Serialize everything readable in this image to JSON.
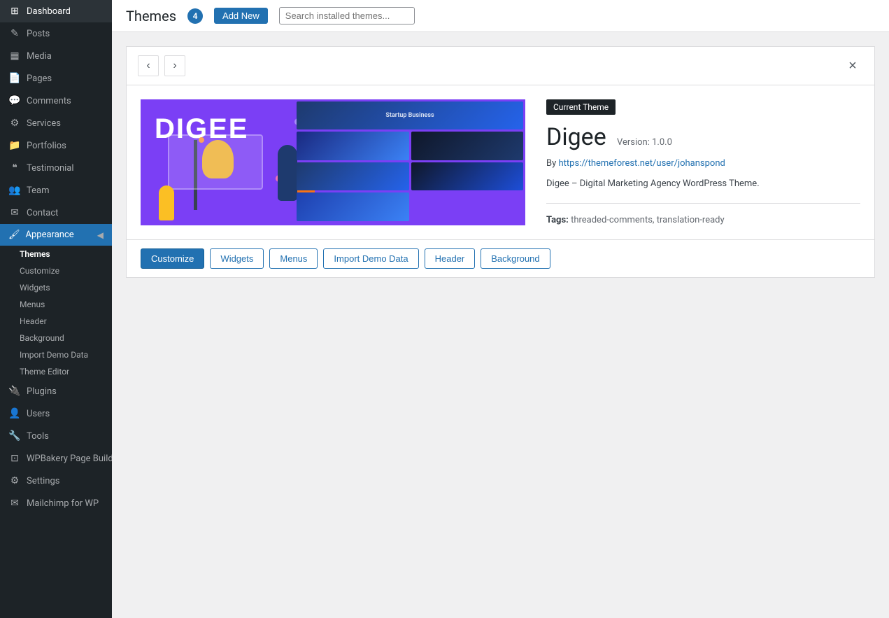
{
  "page_title": "Themes",
  "theme_count": "4",
  "topbar": {
    "title": "Themes",
    "add_new_label": "Add New",
    "search_placeholder": "Search installed themes..."
  },
  "sidebar": {
    "dashboard_label": "Dashboard",
    "posts_label": "Posts",
    "media_label": "Media",
    "pages_label": "Pages",
    "comments_label": "Comments",
    "services_label": "Services",
    "portfolios_label": "Portfolios",
    "testimonial_label": "Testimonial",
    "team_label": "Team",
    "contact_label": "Contact",
    "appearance_label": "Appearance",
    "themes_label": "Themes",
    "customize_label": "Customize",
    "widgets_label": "Widgets",
    "menus_label": "Menus",
    "header_label": "Header",
    "background_label": "Background",
    "import_demo_label": "Import Demo Data",
    "theme_editor_label": "Theme Editor",
    "plugins_label": "Plugins",
    "users_label": "Users",
    "tools_label": "Tools",
    "wpbakery_label": "WPBakery Page Builder",
    "settings_label": "Settings",
    "mailchimp_label": "Mailchimp for WP"
  },
  "theme": {
    "current_badge": "Current Theme",
    "name": "Digee",
    "version_label": "Version: 1.0.0",
    "author_prefix": "By",
    "author_url": "https://themeforest.net/user/johanspond",
    "author_url_text": "https://themeforest.net/user/johanspond",
    "description": "Digee – Digital Marketing Agency WordPress Theme.",
    "tags_label": "Tags:",
    "tags": "threaded-comments, translation-ready"
  },
  "bottom_bar": {
    "customize_label": "Customize",
    "widgets_label": "Widgets",
    "menus_label": "Menus",
    "import_demo_label": "Import Demo Data",
    "header_label": "Header",
    "background_label": "Background"
  },
  "icons": {
    "dashboard": "⊞",
    "posts": "✎",
    "media": "🎞",
    "pages": "📄",
    "comments": "💬",
    "services": "✦",
    "portfolios": "📁",
    "testimonial": "❝",
    "team": "👥",
    "contact": "✉",
    "appearance": "🖌",
    "plugins": "🔌",
    "users": "👤",
    "tools": "🔧",
    "wpbakery": "⊡",
    "settings": "⚙",
    "mailchimp": "✉"
  }
}
